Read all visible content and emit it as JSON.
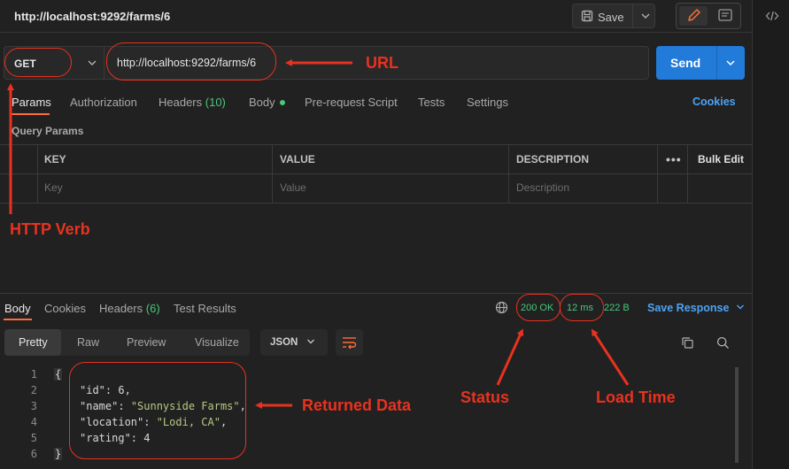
{
  "tab": {
    "title": "http://localhost:9292/farms/6"
  },
  "toolbar": {
    "save_label": "Save"
  },
  "request": {
    "method": "GET",
    "url": "http://localhost:9292/farms/6",
    "send_label": "Send"
  },
  "request_tabs": [
    {
      "label": "Params"
    },
    {
      "label": "Authorization"
    },
    {
      "label": "Headers",
      "badge": "(10)"
    },
    {
      "label": "Body"
    },
    {
      "label": "Pre-request Script"
    },
    {
      "label": "Tests"
    },
    {
      "label": "Settings"
    }
  ],
  "cookies_label": "Cookies",
  "query_params": {
    "title": "Query Params",
    "headers": [
      "KEY",
      "VALUE",
      "DESCRIPTION"
    ],
    "bulk_edit": "Bulk Edit",
    "placeholders": [
      "Key",
      "Value",
      "Description"
    ]
  },
  "response": {
    "tabs": [
      {
        "label": "Body"
      },
      {
        "label": "Cookies"
      },
      {
        "label": "Headers",
        "badge": "(6)"
      },
      {
        "label": "Test Results"
      }
    ],
    "status": "200 OK",
    "time": "12 ms",
    "size": "222 B",
    "save_response_label": "Save Response",
    "format_tabs": [
      "Pretty",
      "Raw",
      "Preview",
      "Visualize"
    ],
    "format": "JSON",
    "line_numbers": [
      "1",
      "2",
      "3",
      "4",
      "5",
      "6"
    ],
    "code_lines": {
      "open": "{",
      "id_key": "\"id\"",
      "id_val": "6",
      "name_key": "\"name\"",
      "name_val": "\"Sunnyside Farms\"",
      "location_key": "\"location\"",
      "location_val": "\"Lodi, CA\"",
      "rating_key": "\"rating\"",
      "rating_val": "4",
      "close": "}"
    }
  },
  "annotations": {
    "url": "URL",
    "http_verb": "HTTP Verb",
    "returned_data": "Returned Data",
    "status": "Status",
    "load_time": "Load Time"
  },
  "colors": {
    "accent": "#ff6c37",
    "send": "#227bd9",
    "link": "#4ba3f5",
    "status_ok": "#49c97a",
    "annotation": "#e8321f"
  },
  "icons": [
    "save-icon",
    "chevron-down-icon",
    "edit-icon",
    "comment-icon",
    "code-icon",
    "globe-icon",
    "copy-icon",
    "search-icon",
    "wrap-lines-icon",
    "more-icon"
  ]
}
